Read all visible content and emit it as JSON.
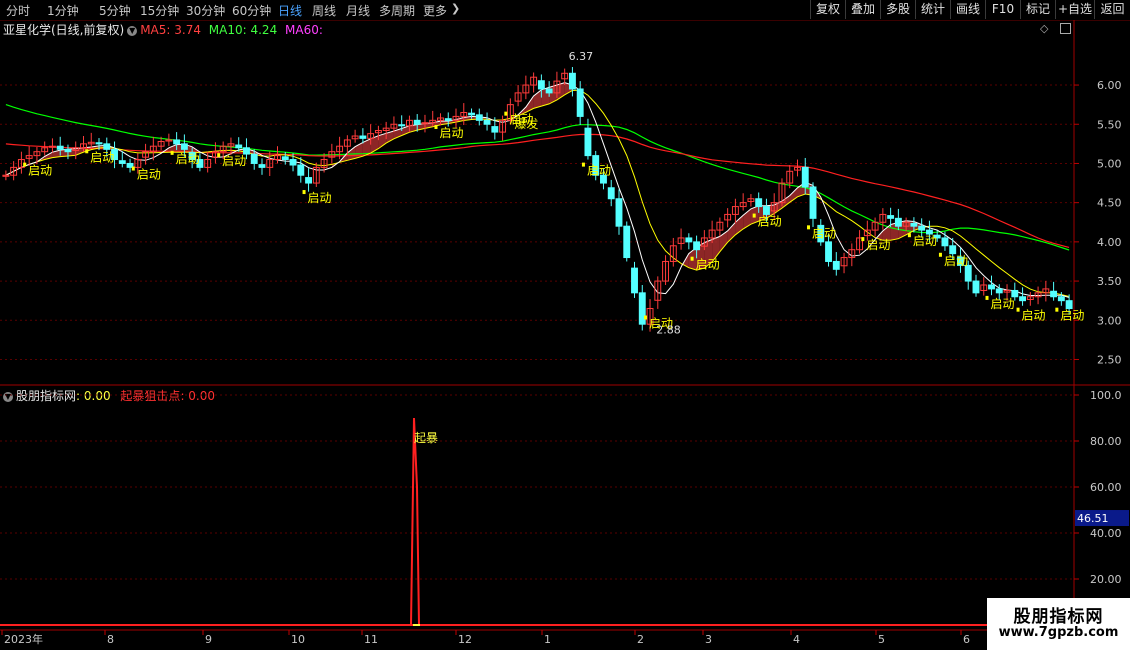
{
  "toolbar": {
    "periods": [
      "分时",
      "1分钟",
      "5分钟",
      "15分钟",
      "30分钟",
      "60分钟",
      "日线",
      "周线",
      "月线",
      "多周期",
      "更多"
    ],
    "active_period": "日线",
    "right_buttons": [
      "复权",
      "叠加",
      "多股",
      "统计",
      "画线",
      "F10",
      "标记",
      "+自选",
      "返回"
    ]
  },
  "main_header": {
    "stock_title": "亚星化学(日线,前复权)",
    "ma5_label": "MA5: 3.74",
    "ma10_label": "MA10: 4.24",
    "ma60_label": "MA60:"
  },
  "indicator_header": {
    "name": "股朋指标网",
    "value": ": 0.00",
    "signal_name": "起暴狙击点",
    "signal_value": ": 0.00"
  },
  "colors": {
    "up": "#ff3b3b",
    "down": "#54ffff",
    "ma5": "#ffffff",
    "ma10": "#ffff00",
    "ma20": "#00ff00",
    "ma60": "#ff2020",
    "signal": "#ffff00",
    "grid": "#5a0000",
    "axis_text": "#c8c8c8"
  },
  "chart_data": [
    {
      "type": "candlestick",
      "y_ticks": [
        "6.00",
        "5.50",
        "5.00",
        "4.50",
        "4.00",
        "3.50",
        "3.00",
        "2.50"
      ],
      "ylim": [
        2.2,
        6.6
      ],
      "annotations": {
        "high": "6.37",
        "low": "2.88"
      },
      "signal_label": "启动",
      "burst_label": "爆发",
      "x_ticks": [
        "2023年",
        "8",
        "9",
        "10",
        "11",
        "12",
        "1",
        "2",
        "3",
        "4",
        "5",
        "6"
      ],
      "series": [
        {
          "name": "MA5",
          "values": [
            3.74
          ]
        },
        {
          "name": "MA10",
          "values": [
            4.24
          ]
        }
      ],
      "ohlc_points": [
        4.85,
        4.95,
        5.05,
        5.1,
        5.15,
        5.2,
        5.22,
        5.18,
        5.15,
        5.2,
        5.25,
        5.27,
        5.25,
        5.18,
        5.05,
        5.0,
        4.95,
        5.05,
        5.15,
        5.22,
        5.28,
        5.3,
        5.25,
        5.18,
        5.05,
        4.95,
        5.05,
        5.15,
        5.22,
        5.25,
        5.2,
        5.12,
        5.0,
        4.95,
        5.05,
        5.1,
        5.05,
        4.98,
        4.85,
        4.75,
        4.95,
        5.05,
        5.15,
        5.22,
        5.3,
        5.35,
        5.32,
        5.38,
        5.42,
        5.45,
        5.5,
        5.48,
        5.55,
        5.5,
        5.52,
        5.55,
        5.58,
        5.55,
        5.6,
        5.65,
        5.62,
        5.55,
        5.5,
        5.4,
        5.55,
        5.75,
        5.9,
        6.0,
        6.1,
        5.95,
        5.9,
        6.05,
        6.15,
        5.95,
        5.6,
        5.1,
        4.85,
        4.75,
        4.55,
        4.2,
        3.8,
        3.35,
        2.95,
        3.15,
        3.5,
        3.75,
        3.95,
        4.05,
        4.0,
        3.9,
        4.05,
        4.15,
        4.25,
        4.35,
        4.45,
        4.5,
        4.55,
        4.45,
        4.35,
        4.5,
        4.75,
        4.9,
        4.95,
        4.7,
        4.3,
        4.0,
        3.75,
        3.65,
        3.8,
        3.9,
        4.05,
        4.15,
        4.25,
        4.35,
        4.3,
        4.2,
        4.25,
        4.2,
        4.15,
        4.1,
        4.05,
        3.95,
        3.85,
        3.7,
        3.5,
        3.35,
        3.45,
        3.4,
        3.35,
        3.38,
        3.3,
        3.25,
        3.3,
        3.35,
        3.4,
        3.3,
        3.25,
        3.15
      ]
    },
    {
      "type": "line",
      "y_ticks": [
        "100.0",
        "80.00",
        "60.00",
        "40.00",
        "20.00"
      ],
      "ylim": [
        0,
        100
      ],
      "current_value": "46.51",
      "spike_label": "起暴",
      "spike_value": 90
    }
  ],
  "watermark": {
    "line1": "股朋指标网",
    "line2": "www.7gpzb.com"
  }
}
